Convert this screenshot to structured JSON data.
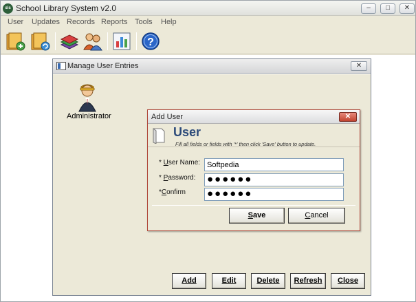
{
  "app": {
    "icon_text": "sls",
    "title": "School Library System v2.0",
    "controls": {
      "minimize": "–",
      "restore": "□",
      "close": "✕"
    }
  },
  "menu": [
    "User",
    "Updates",
    "Records",
    "Reports",
    "Tools",
    "Help"
  ],
  "toolbar": {
    "buttons": [
      "add-book-icon",
      "update-book-icon",
      "records-books-icon",
      "users-group-icon",
      "reports-chart-icon",
      "help-icon"
    ],
    "help_glyph": "?"
  },
  "manage_window": {
    "title": "Manage User Entries",
    "close_glyph": "✕",
    "user_entry": {
      "label": "Administrator",
      "icon": "administrator-user-icon"
    },
    "buttons": {
      "add": "Add",
      "edit": "Edit",
      "delete": "Delete",
      "refresh": "Refresh",
      "close": "Close"
    }
  },
  "add_user_dialog": {
    "title": "Add User",
    "close_glyph": "✕",
    "header_title": "User",
    "header_subtitle": "Fill all fields or fields with '*' then click 'Save' button to update.",
    "fields": {
      "username_prefix": "* ",
      "username_key": "U",
      "username_rest": "ser Name:",
      "username_value": "Softpedia",
      "password_prefix": "* ",
      "password_key": "P",
      "password_rest": "assword:",
      "password_value": "●●●●●●",
      "confirm_prefix": "*",
      "confirm_key": "C",
      "confirm_rest": "onfirm",
      "confirm_value": "●●●●●●"
    },
    "buttons": {
      "save_key": "S",
      "save_rest": "ave",
      "cancel_key": "C",
      "cancel_rest": "ancel"
    }
  }
}
